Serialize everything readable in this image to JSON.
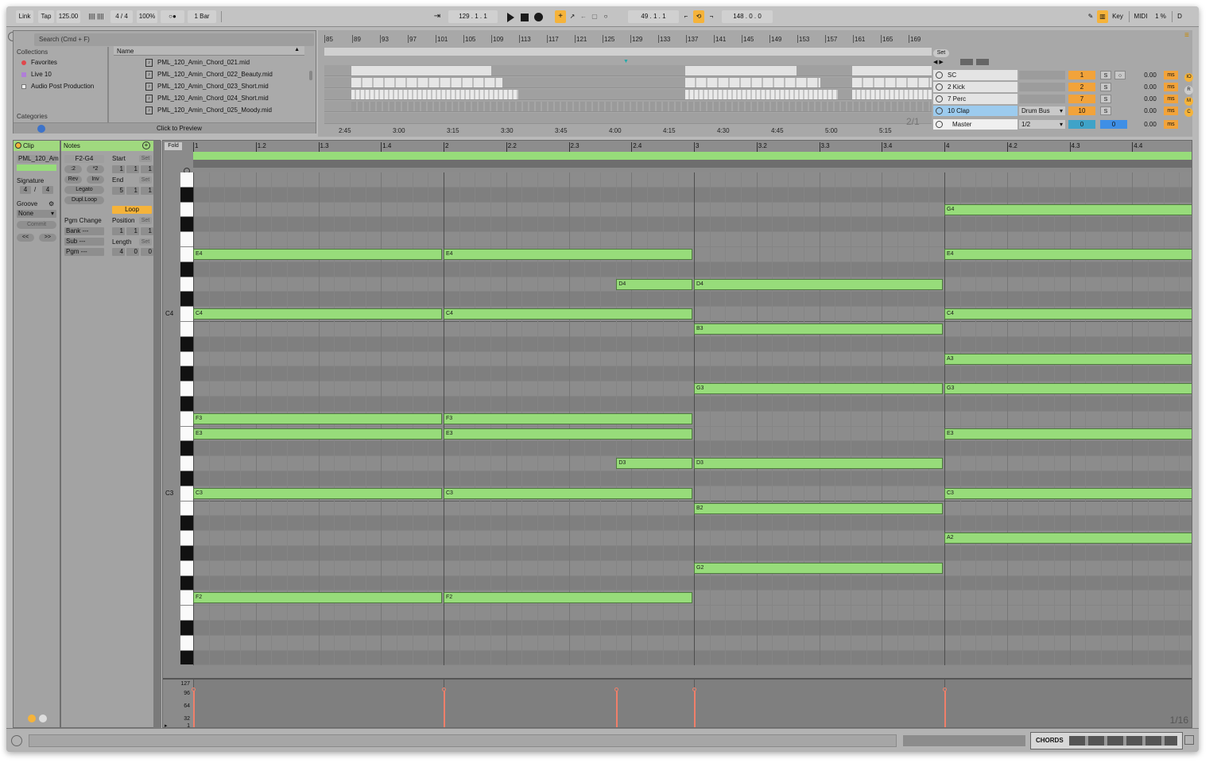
{
  "transport": {
    "link": "Link",
    "tap": "Tap",
    "tempo": "125.00",
    "meter_bars": "|||| ||||",
    "signature": "4 / 4",
    "zoom": "100%",
    "metro": "○●",
    "quantize": "1 Bar",
    "position": "129 .  1 .  1",
    "loop_start": "49 .  1 .  1",
    "loop_length": "148 .  0 .  0",
    "key": "Key",
    "midi": "MIDI",
    "cpu": "1 %",
    "d": "D"
  },
  "browser": {
    "search_placeholder": "Search (Cmd + F)",
    "collections_header": "Collections",
    "collections": [
      {
        "label": "Favorites",
        "color": "#e0474c"
      },
      {
        "label": "Live 10",
        "color": "#b07ed8"
      },
      {
        "label": "Audio Post Production",
        "color": "#e6e6e6"
      }
    ],
    "categories_header": "Categories",
    "name_header": "Name",
    "files": [
      "PML_120_Amin_Chord_021.mid",
      "PML_120_Amin_Chord_022_Beauty.mid",
      "PML_120_Amin_Chord_023_Short.mid",
      "PML_120_Amin_Chord_024_Short.mid",
      "PML_120_Amin_Chord_025_Moody.mid"
    ],
    "preview": "Click to Preview"
  },
  "arrangement": {
    "ruler": [
      "85",
      "89",
      "93",
      "97",
      "101",
      "105",
      "109",
      "113",
      "117",
      "121",
      "125",
      "129",
      "133",
      "137",
      "141",
      "145",
      "149",
      "153",
      "157",
      "161",
      "165",
      "169"
    ],
    "times": [
      "2:45",
      "3:00",
      "3:15",
      "3:30",
      "3:45",
      "4:00",
      "4:15",
      "4:30",
      "4:45",
      "5:00",
      "5:15"
    ],
    "set_label": "Set",
    "page_indicator": "2/1",
    "tracks": [
      {
        "name": "SC",
        "num": "1",
        "vol": "0.00",
        "route": ""
      },
      {
        "name": "2 Kick",
        "num": "2",
        "vol": "0.00",
        "route": ""
      },
      {
        "name": "7 Perc",
        "num": "7",
        "vol": "0.00",
        "route": ""
      },
      {
        "name": "10 Clap",
        "num": "10",
        "vol": "0.00",
        "route": "Drum Bus"
      },
      {
        "name": "Master",
        "num": "0",
        "vol": "0.00",
        "route": "1/2"
      }
    ],
    "solo": "S",
    "ms": "ms"
  },
  "clip": {
    "clip_header": "Clip",
    "notes_header": "Notes",
    "clip_name": "PML_120_Am",
    "signature_label": "Signature",
    "sig_num": "4",
    "sig_den": "4",
    "groove_label": "Groove",
    "groove_value": "None",
    "commit": "Commit",
    "nav_left": "<<",
    "nav_right": ">>",
    "range": "F2-G4",
    "half": ":2",
    "double": "*2",
    "rev": "Rev",
    "inv": "Inv",
    "legato": "Legato",
    "dupl": "Dupl.Loop",
    "start_label": "Start",
    "end_label": "End",
    "set": "Set",
    "start": [
      "1",
      "1",
      "1"
    ],
    "end": [
      "5",
      "1",
      "1"
    ],
    "loop": "Loop",
    "pgm_change": "Pgm Change",
    "bank": "Bank ---",
    "sub": "Sub ---",
    "pgm": "Pgm ---",
    "position_label": "Position",
    "position": [
      "1",
      "1",
      "1"
    ],
    "length_label": "Length",
    "length": [
      "4",
      "0",
      "0"
    ]
  },
  "pianoroll": {
    "fold": "Fold",
    "bars": [
      "1",
      "1.2",
      "1.3",
      "1.4",
      "2",
      "2.2",
      "2.3",
      "2.4",
      "3",
      "3.2",
      "3.3",
      "3.4",
      "4",
      "4.2",
      "4.3",
      "4.4"
    ],
    "oct_labels": [
      {
        "label": "C4",
        "row": 10
      },
      {
        "label": "C3",
        "row": 22
      }
    ],
    "vel_labels": [
      "127",
      "96",
      "64",
      "32",
      "1"
    ],
    "grid_label": "1/16",
    "notes": [
      {
        "pitch": "G4",
        "start": 3.0,
        "len": 1.0
      },
      {
        "pitch": "E4",
        "start": 0.0,
        "len": 1.0
      },
      {
        "pitch": "E4",
        "start": 1.0,
        "len": 1.0
      },
      {
        "pitch": "E4",
        "start": 3.0,
        "len": 1.0
      },
      {
        "pitch": "D4",
        "start": 1.69,
        "len": 0.31
      },
      {
        "pitch": "D4",
        "start": 2.0,
        "len": 1.0
      },
      {
        "pitch": "C4",
        "start": 0.0,
        "len": 1.0
      },
      {
        "pitch": "C4",
        "start": 1.0,
        "len": 1.0
      },
      {
        "pitch": "C4",
        "start": 3.0,
        "len": 1.0
      },
      {
        "pitch": "B3",
        "start": 2.0,
        "len": 1.0
      },
      {
        "pitch": "A3",
        "start": 3.0,
        "len": 1.0
      },
      {
        "pitch": "G3",
        "start": 2.0,
        "len": 1.0
      },
      {
        "pitch": "G3",
        "start": 3.0,
        "len": 1.0
      },
      {
        "pitch": "F3",
        "start": 0.0,
        "len": 1.0
      },
      {
        "pitch": "F3",
        "start": 1.0,
        "len": 1.0
      },
      {
        "pitch": "E3",
        "start": 0.0,
        "len": 1.0
      },
      {
        "pitch": "E3",
        "start": 1.0,
        "len": 1.0
      },
      {
        "pitch": "E3",
        "start": 3.0,
        "len": 1.0
      },
      {
        "pitch": "D3",
        "start": 1.69,
        "len": 0.31
      },
      {
        "pitch": "D3",
        "start": 2.0,
        "len": 1.0
      },
      {
        "pitch": "C3",
        "start": 0.0,
        "len": 1.0
      },
      {
        "pitch": "C3",
        "start": 1.0,
        "len": 1.0
      },
      {
        "pitch": "C3",
        "start": 3.0,
        "len": 1.0
      },
      {
        "pitch": "B2",
        "start": 2.0,
        "len": 1.0
      },
      {
        "pitch": "A2",
        "start": 3.0,
        "len": 1.0
      },
      {
        "pitch": "G2",
        "start": 2.0,
        "len": 1.0
      },
      {
        "pitch": "F2",
        "start": 0.0,
        "len": 1.0
      },
      {
        "pitch": "F2",
        "start": 1.0,
        "len": 1.0
      }
    ],
    "velocities": [
      0.0,
      1.0,
      1.69,
      2.0,
      3.0
    ]
  },
  "statusbar": {
    "chords": "CHORDS"
  }
}
